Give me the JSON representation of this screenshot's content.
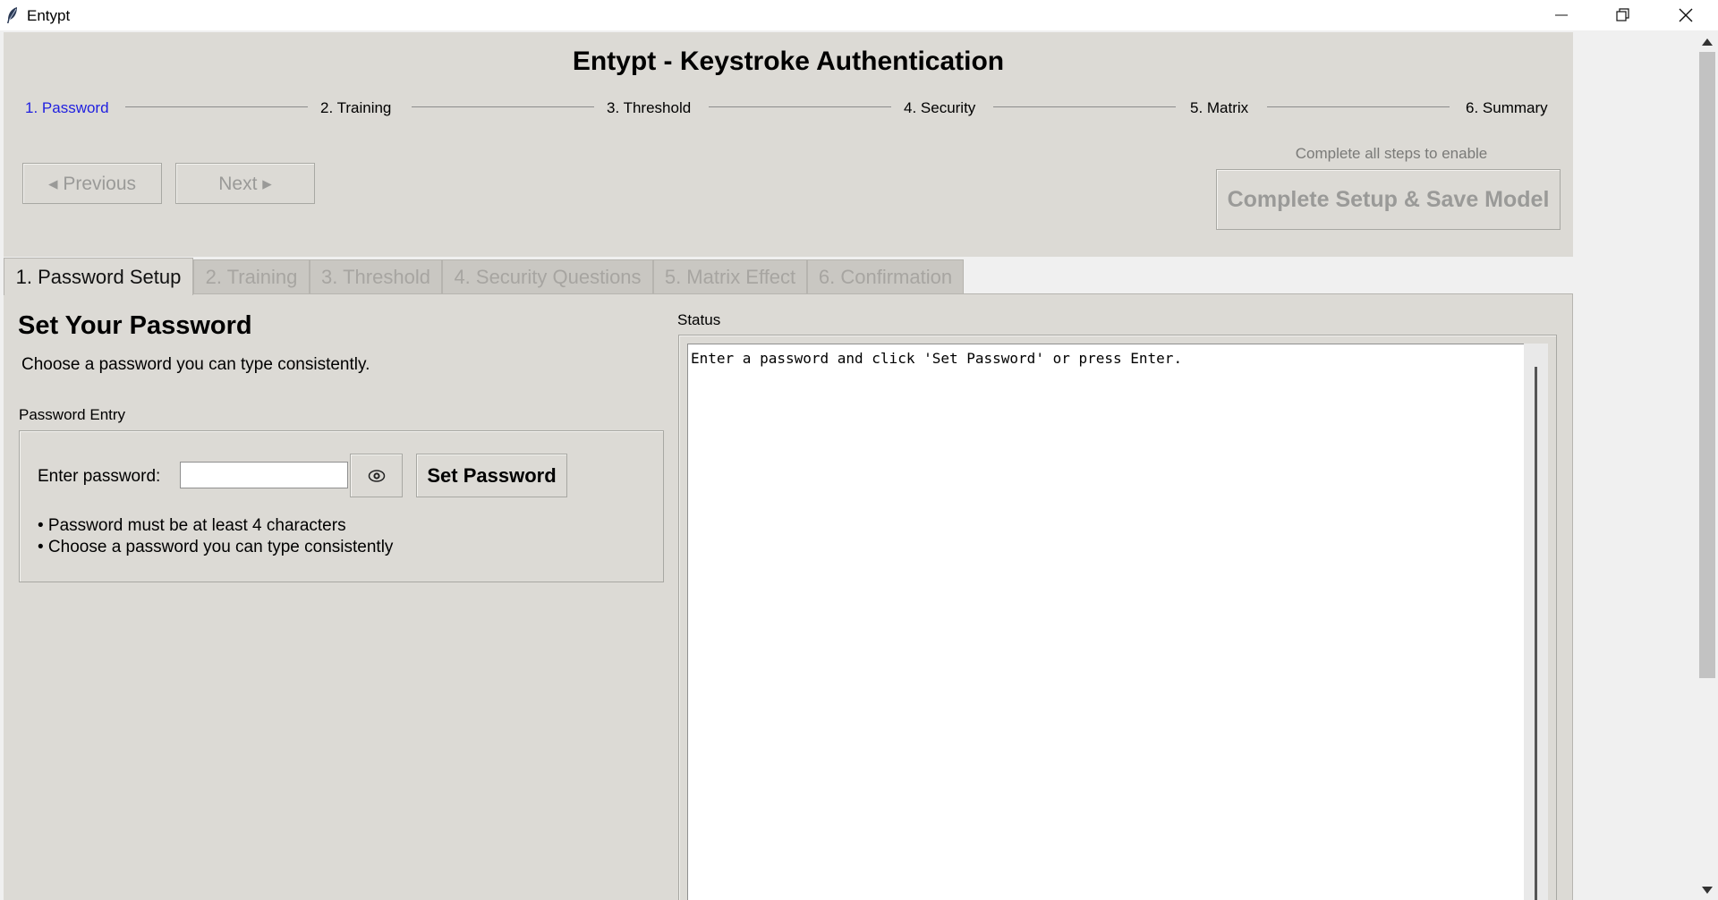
{
  "window": {
    "title": "Entypt",
    "icons": {
      "app": "feather-icon",
      "minimize": "minimize-icon",
      "restore": "restore-icon",
      "close": "close-icon"
    }
  },
  "header": {
    "title": "Entypt - Keystroke Authentication",
    "steps": [
      {
        "label": "1. Password",
        "active": true
      },
      {
        "label": "2. Training",
        "active": false
      },
      {
        "label": "3. Threshold",
        "active": false
      },
      {
        "label": "4. Security",
        "active": false
      },
      {
        "label": "5. Matrix",
        "active": false
      },
      {
        "label": "6. Summary",
        "active": false
      }
    ],
    "previous_label": "◂ Previous",
    "next_label": "Next ▸",
    "complete_hint": "Complete all steps to enable",
    "complete_label": "Complete Setup & Save Model"
  },
  "tabs": [
    {
      "label": "1. Password Setup",
      "active": true
    },
    {
      "label": "2. Training",
      "active": false
    },
    {
      "label": "3. Threshold",
      "active": false
    },
    {
      "label": "4. Security Questions",
      "active": false
    },
    {
      "label": "5. Matrix Effect",
      "active": false
    },
    {
      "label": "6. Confirmation",
      "active": false
    }
  ],
  "password_setup": {
    "title": "Set Your Password",
    "subtitle": "Choose a password you can type consistently.",
    "entry_group_label": "Password Entry",
    "enter_label": "Enter password:",
    "input_value": "",
    "eye_icon": "eye-icon",
    "set_button": "Set Password",
    "hints": [
      "• Password must be at least 4 characters",
      "• Choose a password you can type consistently"
    ]
  },
  "status": {
    "label": "Status",
    "text": "Enter a password and click 'Set Password' or press Enter."
  },
  "colors": {
    "panel_bg": "#dcdad5",
    "active_step": "#1f1fe0",
    "disabled_text": "#9a9a98"
  }
}
